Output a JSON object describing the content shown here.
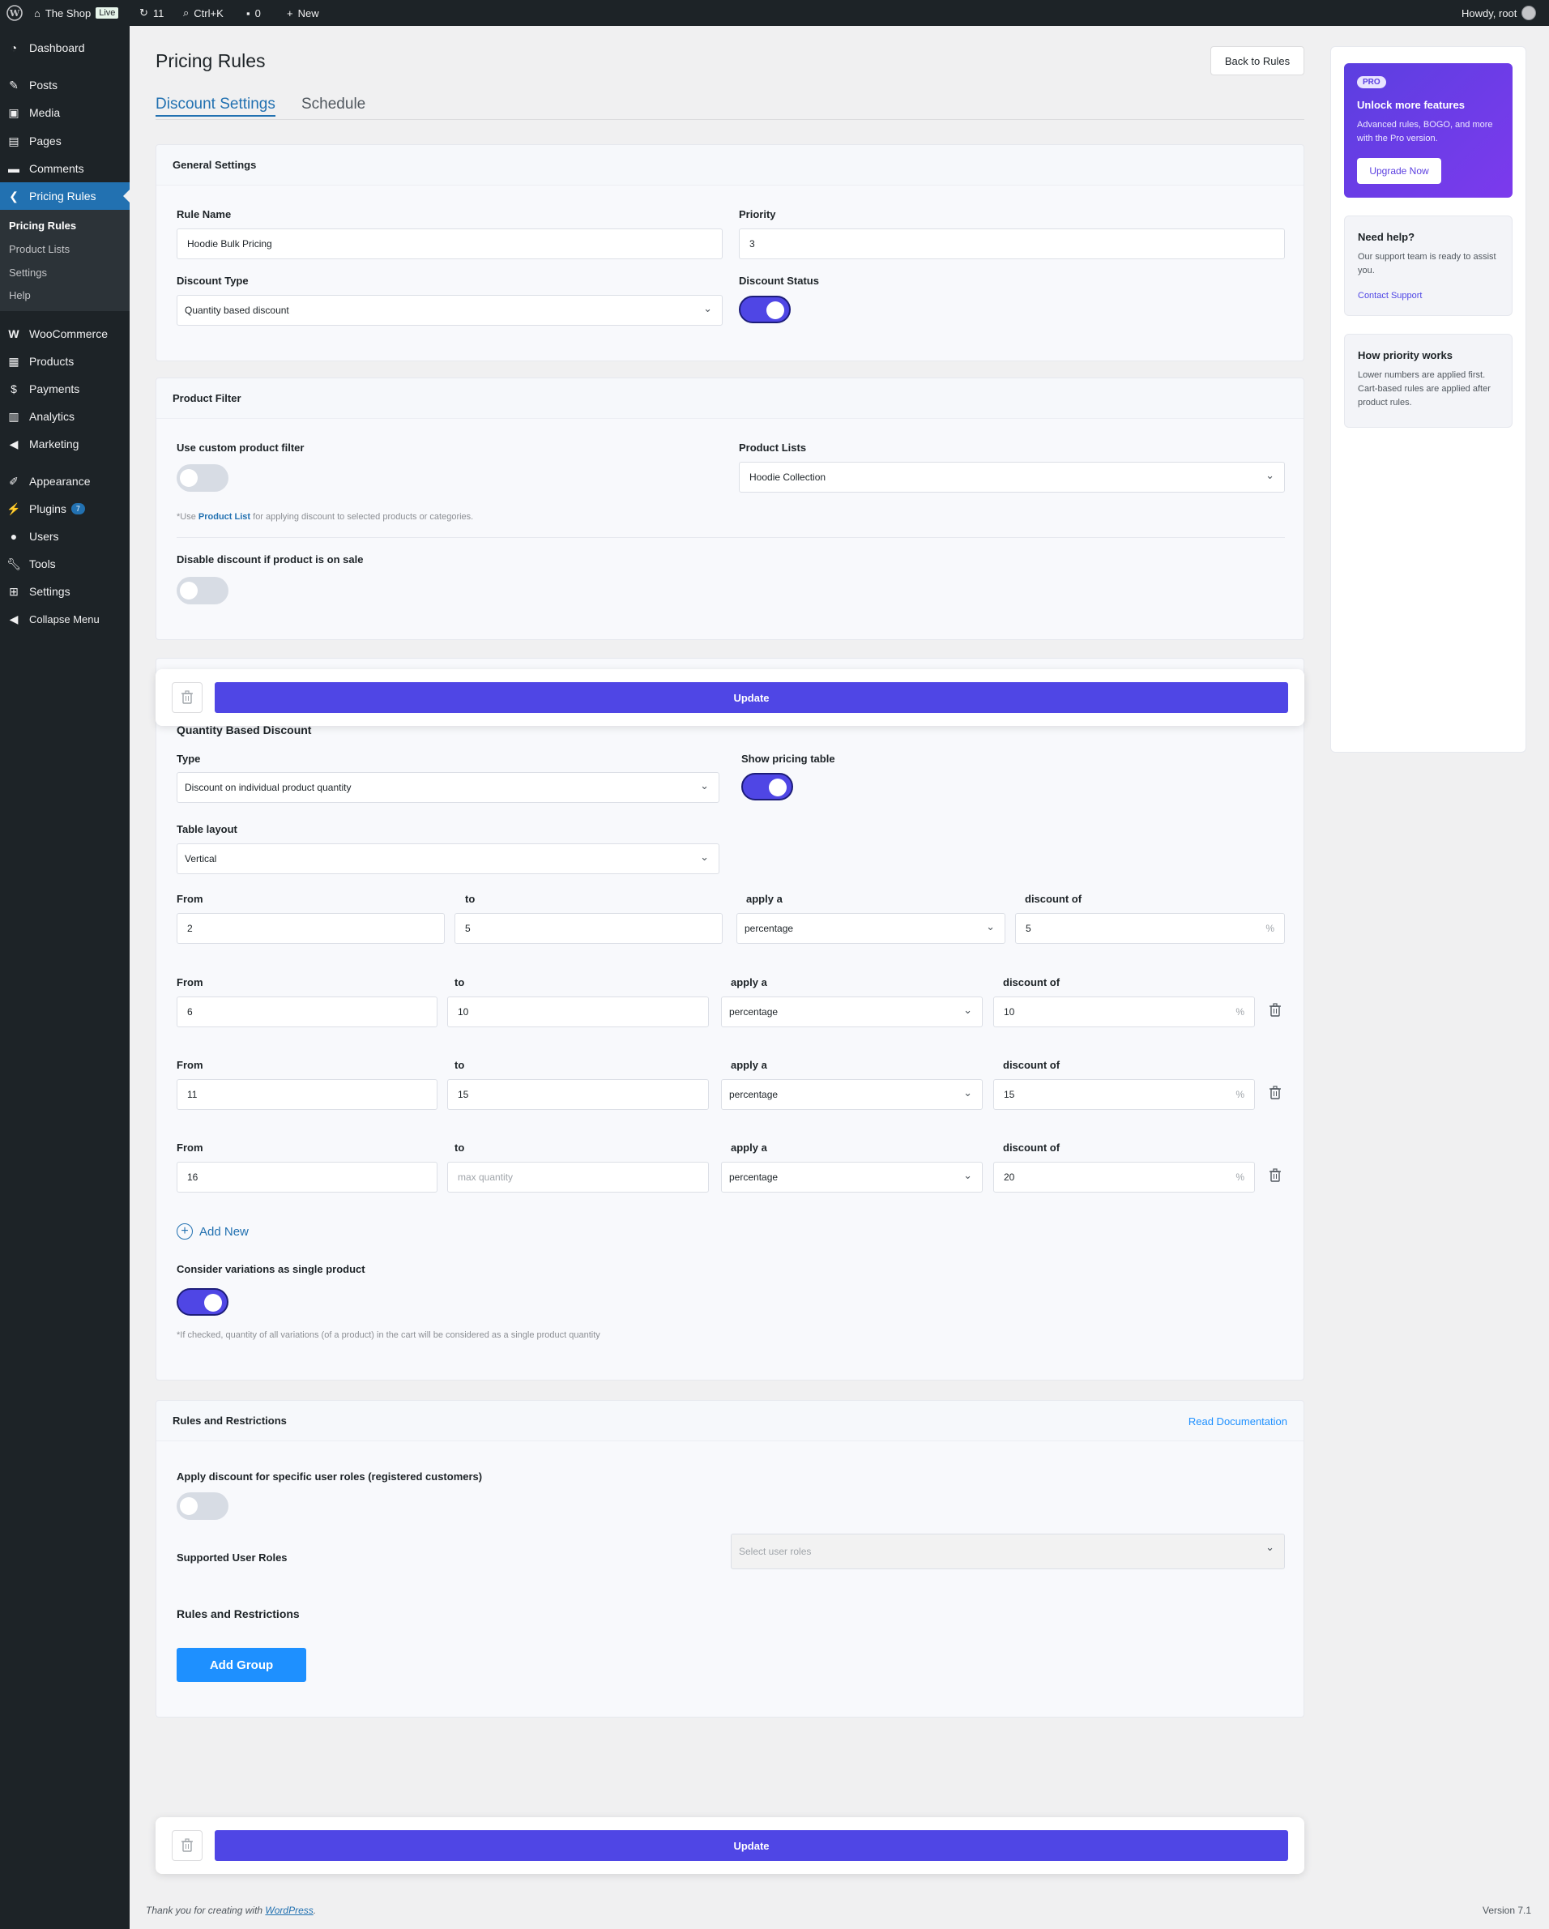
{
  "admin_bar": {
    "site_name": "The Shop",
    "live_badge": "Live",
    "updates_count": "11",
    "search_shortcut": "Ctrl+K",
    "comments_count": "0",
    "new_label": "New",
    "greeting": "Howdy, root"
  },
  "sidebar": {
    "items": [
      {
        "label": "Dashboard",
        "icon": "dashboard-icon"
      },
      {
        "label": "Posts",
        "icon": "pin-icon"
      },
      {
        "label": "Media",
        "icon": "media-icon"
      },
      {
        "label": "Pages",
        "icon": "pages-icon"
      },
      {
        "label": "Comments",
        "icon": "comment-icon"
      },
      {
        "label": "Pricing Rules",
        "icon": "chevron-left-icon"
      },
      {
        "label": "WooCommerce",
        "icon": "woo-icon"
      },
      {
        "label": "Products",
        "icon": "archive-icon"
      },
      {
        "label": "Payments",
        "icon": "dollar-icon"
      },
      {
        "label": "Analytics",
        "icon": "bar-chart-icon"
      },
      {
        "label": "Marketing",
        "icon": "megaphone-icon"
      },
      {
        "label": "Appearance",
        "icon": "brush-icon"
      },
      {
        "label": "Plugins",
        "icon": "plug-icon",
        "badge": "7"
      },
      {
        "label": "Users",
        "icon": "user-icon"
      },
      {
        "label": "Tools",
        "icon": "wrench-icon"
      },
      {
        "label": "Settings",
        "icon": "settings-icon"
      },
      {
        "label": "Collapse Menu",
        "icon": "collapse-icon"
      }
    ],
    "submenu": [
      "Pricing Rules",
      "Product Lists",
      "Settings",
      "Help"
    ]
  },
  "page": {
    "title": "Pricing Rules",
    "back_button": "Back to Rules",
    "tabs": [
      "Discount Settings",
      "Schedule"
    ]
  },
  "general": {
    "heading": "General Settings",
    "rule_name_label": "Rule Name",
    "rule_name_value": "Hoodie Bulk Pricing",
    "priority_label": "Priority",
    "priority_value": "3",
    "discount_type_label": "Discount Type",
    "discount_type_value": "Quantity based discount",
    "discount_status_label": "Discount Status",
    "discount_status_on": true
  },
  "product_filter": {
    "heading": "Product Filter",
    "custom_filter_label": "Use custom product filter",
    "custom_filter_on": false,
    "product_lists_label": "Product Lists",
    "product_lists_value": "Hoodie Collection",
    "hint_prefix": "*Use ",
    "hint_link": "Product List",
    "hint_suffix": " for applying discount to selected products or categories.",
    "disable_on_sale_label": "Disable discount if product is on sale",
    "disable_on_sale_on": false
  },
  "update_bar": {
    "button_label": "Update"
  },
  "quantity": {
    "heading": "Quantity Based Discount",
    "type_label": "Type",
    "type_value": "Discount on individual product quantity",
    "show_table_label": "Show pricing table",
    "show_table_on": true,
    "layout_label": "Table layout",
    "layout_value": "Vertical",
    "col_from": "From",
    "col_to": "to",
    "col_apply": "apply a",
    "col_discount": "discount of",
    "rows": [
      {
        "from": "2",
        "to": "5",
        "apply": "percentage",
        "discount": "5",
        "unit": "%"
      },
      {
        "from": "6",
        "to": "10",
        "apply": "percentage",
        "discount": "10",
        "unit": "%"
      },
      {
        "from": "11",
        "to": "15",
        "apply": "percentage",
        "discount": "15",
        "unit": "%"
      },
      {
        "from": "16",
        "to": "",
        "to_placeholder": "max quantity",
        "apply": "percentage",
        "discount": "20",
        "unit": "%"
      }
    ],
    "add_new_label": "Add New",
    "variations_label": "Consider variations as single product",
    "variations_on": true,
    "variations_hint": "*If checked, quantity of all variations (of a product) in the cart will be considered as a single product quantity"
  },
  "restrictions": {
    "heading": "Rules and Restrictions",
    "doc_link": "Read Documentation",
    "user_roles_label": "Apply discount for specific user roles (registered customers)",
    "user_roles_on": false,
    "supported_roles_label": "Supported User Roles",
    "supported_roles_placeholder": "Select user roles",
    "subheading": "Rules and Restrictions",
    "add_group_label": "Add Group"
  },
  "side": {
    "promo_badge": "PRO",
    "promo_title": "Unlock more features",
    "promo_text": "Advanced rules, BOGO, and more with the Pro version.",
    "promo_button": "Upgrade Now",
    "help_title": "Need help?",
    "help_text": "Our support team is ready to assist you.",
    "help_link": "Contact Support",
    "priority_title": "How priority works",
    "priority_text": "Lower numbers are applied first. Cart-based rules are applied after product rules."
  },
  "footer": {
    "thanks_prefix": "Thank you for creating with ",
    "thanks_link": "WordPress",
    "thanks_suffix": ".",
    "version": "Version 7.1"
  },
  "colors": {
    "accent": "#4f46e5",
    "wp_blue": "#2271b1",
    "add_group_blue": "#1e90ff",
    "admin_dark": "#1d2327"
  }
}
